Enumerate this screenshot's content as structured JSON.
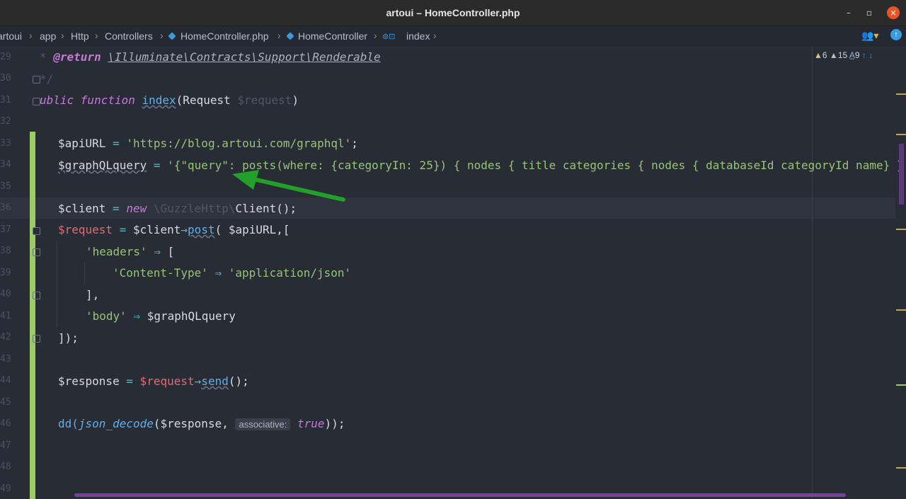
{
  "window": {
    "title": "artoui – HomeController.php"
  },
  "breadcrumb": {
    "items": [
      "artoui",
      "app",
      "Http",
      "Controllers",
      "HomeController.php",
      "HomeController",
      "index"
    ]
  },
  "inspections": {
    "warnings": "6",
    "weak_warnings": "15",
    "typos": "9"
  },
  "gutter": {
    "lines": [
      "29",
      "30",
      "31",
      "32",
      "33",
      "34",
      "35",
      "36",
      "37",
      "38",
      "39",
      "40",
      "41",
      "42",
      "43",
      "44",
      "45",
      "46",
      "47",
      "48",
      "49"
    ]
  },
  "code": {
    "l29_tag": "@return",
    "l29_type": "\\Illuminate\\Contracts\\Support\\Renderable",
    "l30": "*/",
    "l31_kw": "ublic function",
    "l31_fn": "index",
    "l31_rest1": "(Request ",
    "l31_param": "$request",
    "l31_rest2": ")",
    "l33_var": "$apiURL",
    "l33_eq": " = ",
    "l33_str": "'https://blog.artoui.com/graphql'",
    "l33_end": ";",
    "l34_var": "$graphQLquery",
    "l34_eq": " = ",
    "l34_str": "'{\"query\": posts(where: {categoryIn: 25}) { nodes { title categories { nodes { databaseId categoryId name} }",
    "l36_var": "$client",
    "l36_eq": " = ",
    "l36_new": "new",
    "l36_ns": " \\GuzzleHttp\\",
    "l36_cls": "Client",
    "l36_end": "();",
    "l37_req": "$request",
    "l37_eq": " = ",
    "l37_client": "$client",
    "l37_arrow": "→",
    "l37_post": "post",
    "l37_rest": "( $apiURL,[",
    "l38_key": "'headers'",
    "l38_arrow": " ⇒ ",
    "l38_rest": "[",
    "l39_key": "'Content-Type'",
    "l39_arrow": " ⇒ ",
    "l39_val": "'application/json'",
    "l40": "],",
    "l41_key": "'body'",
    "l41_arrow": " ⇒ ",
    "l41_val": "$graphQLquery",
    "l42": "]);",
    "l44_var": "$response",
    "l44_eq": " = ",
    "l44_req": "$request",
    "l44_arrow": "→",
    "l44_send": "send",
    "l44_end": "();",
    "l46_dd": "dd(",
    "l46_fn": "json_decode",
    "l46_args": "($response, ",
    "l46_hint": "associative:",
    "l46_bool": "true",
    "l46_end": "));"
  },
  "colors": {
    "accent": "#3b9be0",
    "change_bar": "#9ccc65",
    "arrow": "#22a02a",
    "close": "#e95420"
  }
}
